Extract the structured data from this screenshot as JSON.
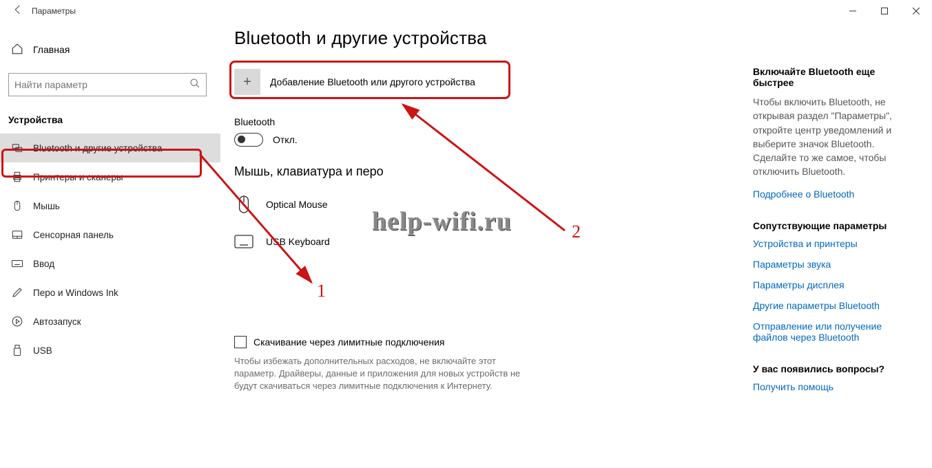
{
  "titlebar": {
    "title": "Параметры"
  },
  "sidebar": {
    "home": "Главная",
    "search_placeholder": "Найти параметр",
    "section": "Устройства",
    "items": [
      {
        "label": "Bluetooth и другие устройства",
        "icon": "bluetooth"
      },
      {
        "label": "Принтеры и сканеры",
        "icon": "printer"
      },
      {
        "label": "Мышь",
        "icon": "mouse"
      },
      {
        "label": "Сенсорная панель",
        "icon": "touchpad"
      },
      {
        "label": "Ввод",
        "icon": "keyboard"
      },
      {
        "label": "Перо и Windows Ink",
        "icon": "pen"
      },
      {
        "label": "Автозапуск",
        "icon": "autoplay"
      },
      {
        "label": "USB",
        "icon": "usb"
      }
    ]
  },
  "main": {
    "title": "Bluetooth и другие устройства",
    "add_label": "Добавление Bluetooth или другого устройства",
    "bt_label": "Bluetooth",
    "bt_state": "Откл.",
    "devices_head": "Мышь, клавиатура и перо",
    "devices": [
      {
        "name": "Optical Mouse",
        "icon": "mouse"
      },
      {
        "name": "USB Keyboard",
        "icon": "keyboard"
      }
    ],
    "checkbox_label": "Скачивание через лимитные подключения",
    "checkbox_desc": "Чтобы избежать дополнительных расходов, не включайте этот параметр. Драйверы, данные и приложения для новых устройств не будут скачиваться через лимитные подключения к Интернету."
  },
  "right": {
    "block1_title": "Включайте Bluetooth еще быстрее",
    "block1_text": "Чтобы включить Bluetooth, не открывая раздел \"Параметры\", откройте центр уведомлений и выберите значок Bluetooth. Сделайте то же самое, чтобы отключить Bluetooth.",
    "block1_link": "Подробнее о Bluetooth",
    "block2_title": "Сопутствующие параметры",
    "links2": [
      "Устройства и принтеры",
      "Параметры звука",
      "Параметры дисплея",
      "Другие параметры Bluetooth",
      "Отправление или получение файлов через Bluetooth"
    ],
    "block3_title": "У вас появились вопросы?",
    "block3_link": "Получить помощь"
  },
  "annotations": {
    "n1": "1",
    "n2": "2",
    "watermark": "help-wifi.ru"
  }
}
